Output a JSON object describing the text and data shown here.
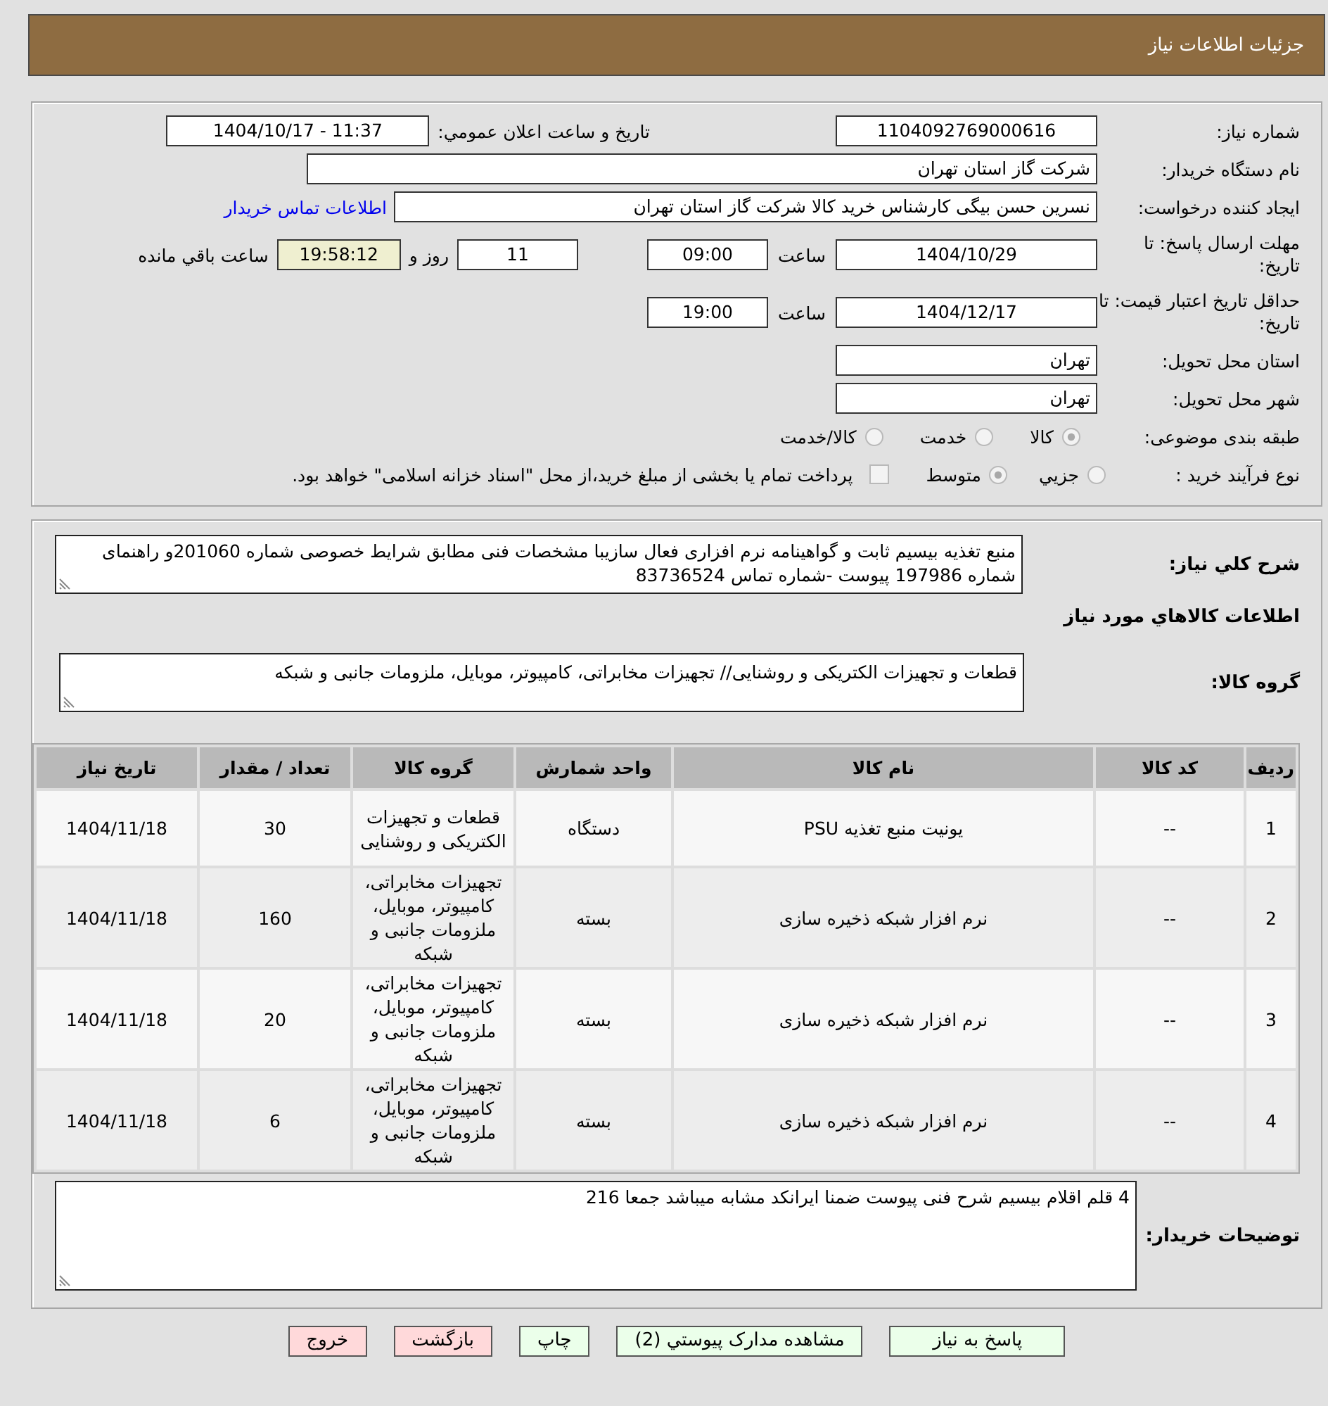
{
  "header": {
    "title": "جزئیات اطلاعات نیاز"
  },
  "details": {
    "need_number": {
      "label": "شماره نیاز:",
      "value": "1104092769000616"
    },
    "announcement": {
      "label": "تاريخ و ساعت اعلان عمومي:",
      "value": "1404/10/17 - 11:37"
    },
    "buyer_org": {
      "label": "نام دستگاه خریدار:",
      "value": "شرکت گاز استان تهران"
    },
    "requester": {
      "label": "ایجاد کننده درخواست:",
      "value": "نسرین حسن بیگی کارشناس خرید کالا شرکت گاز استان تهران",
      "contact_link": "اطلاعات تماس خریدار"
    },
    "response_deadline": {
      "label": "مهلت ارسال پاسخ: تا تاریخ:",
      "date": "1404/10/29",
      "time_label": "ساعت",
      "time": "09:00",
      "days": "11",
      "days_label": "روز و",
      "remaining": "19:58:12",
      "remaining_label": "ساعت باقي مانده"
    },
    "price_validity": {
      "label": "حداقل تاریخ اعتبار قیمت: تا تاریخ:",
      "date": "1404/12/17",
      "time_label": "ساعت",
      "time": "19:00"
    },
    "delivery_province": {
      "label": "استان محل تحویل:",
      "value": "تهران"
    },
    "delivery_city": {
      "label": "شهر محل تحویل:",
      "value": "تهران"
    },
    "subject_category": {
      "label": "طبقه بندی موضوعی:",
      "options": [
        {
          "label": "کالا",
          "selected": true
        },
        {
          "label": "خدمت",
          "selected": false
        },
        {
          "label": "کالا/خدمت",
          "selected": false
        }
      ]
    },
    "purchase_type": {
      "label": "نوع فرآیند خرید :",
      "options": [
        {
          "label": "جزيي",
          "selected": false
        },
        {
          "label": "متوسط",
          "selected": true
        }
      ],
      "treasury_payment": {
        "label": "پرداخت تمام یا بخشی از مبلغ خرید،از محل \"اسناد خزانه اسلامی\" خواهد بود.",
        "checked": false
      }
    }
  },
  "goods": {
    "description": {
      "label": "شرح کلي نیاز:",
      "value": "منبع تغذیه بیسیم ثابت و گواهینامه نرم افزاری فعال سازیبا مشخصات فنی مطابق شرایط خصوصی شماره 201060و راهنمای شماره 197986 پیوست -شماره تماس 83736524"
    },
    "heading": "اطلاعات کالاهاي مورد نیاز",
    "group": {
      "label": "گروه کالا:",
      "value": "قطعات و تجهیزات الکتریکی و روشنایی// تجهیزات مخابراتی، کامپیوتر، موبایل، ملزومات جانبی و شبکه"
    },
    "table": {
      "columns": [
        "ردیف",
        "کد کالا",
        "نام کالا",
        "واحد شمارش",
        "گروه کالا",
        "تعداد / مقدار",
        "تاریخ نیاز"
      ],
      "rows": [
        [
          "1",
          "--",
          "یونیت منبع تغذیه PSU",
          "دستگاه",
          "قطعات و تجهیزات الکتریکی و روشنایی",
          "30",
          "1404/11/18"
        ],
        [
          "2",
          "--",
          "نرم افزار شبکه ذخیره سازی",
          "بسته",
          "تجهیزات مخابراتی، کامپیوتر، موبایل، ملزومات جانبی و شبکه",
          "160",
          "1404/11/18"
        ],
        [
          "3",
          "--",
          "نرم افزار شبکه ذخیره سازی",
          "بسته",
          "تجهیزات مخابراتی، کامپیوتر، موبایل، ملزومات جانبی و شبکه",
          "20",
          "1404/11/18"
        ],
        [
          "4",
          "--",
          "نرم افزار شبکه ذخیره سازی",
          "بسته",
          "تجهیزات مخابراتی، کامپیوتر، موبایل، ملزومات جانبی و شبکه",
          "6",
          "1404/11/18"
        ]
      ]
    },
    "buyer_notes": {
      "label": "توضیحات خریدار:",
      "value": "4 قلم اقلام بیسیم شرح فنی پیوست ضمنا ایرانکد مشابه میباشد جمعا 216"
    }
  },
  "buttons": [
    {
      "label": "پاسخ به نیاز",
      "kind": "action"
    },
    {
      "label": "مشاهده مدارک پیوستي (2)",
      "kind": "action"
    },
    {
      "label": "چاپ",
      "kind": "action"
    },
    {
      "label": "بازگشت",
      "kind": "exit"
    },
    {
      "label": "خروج",
      "kind": "exit"
    }
  ]
}
